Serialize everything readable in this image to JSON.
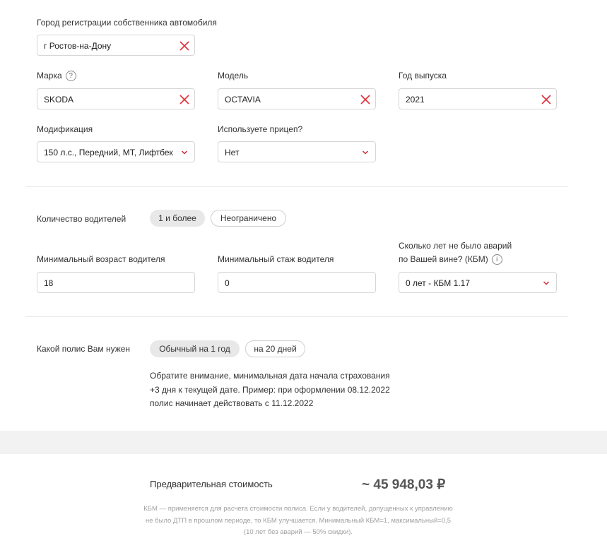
{
  "vehicle": {
    "city_label": "Город регистрации собственника автомобиля",
    "city_value": "г Ростов-на-Дону",
    "brand_label": "Марка",
    "brand_help": "?",
    "brand_value": "SKODA",
    "model_label": "Модель",
    "model_value": "OCTAVIA",
    "year_label": "Год выпуска",
    "year_value": "2021",
    "modification_label": "Модификация",
    "modification_value": "150 л.с., Передний, МТ, Лифтбек",
    "trailer_label": "Используете прицеп?",
    "trailer_value": "Нет"
  },
  "drivers": {
    "count_label": "Количество водителей",
    "count_options": [
      "1 и более",
      "Неограничено"
    ],
    "count_selected": "1 и более",
    "min_age_label": "Минимальный возраст водителя",
    "min_age_value": "18",
    "min_exp_label": "Минимальный стаж водителя",
    "min_exp_value": "0",
    "kbm_label_line1": "Сколько лет не было аварий",
    "kbm_label_line2": "по Вашей вине? (КБМ)",
    "kbm_info": "i",
    "kbm_value": "0 лет - КБМ 1.17"
  },
  "policy": {
    "label": "Какой полис Вам нужен",
    "options": [
      "Обычный на 1 год",
      "на 20 дней"
    ],
    "selected": "Обычный на 1 год",
    "notice_line1": "Обратите внимание, минимальная дата начала страхования",
    "notice_line2": "+3 дня к текущей дате. Пример: при оформлении 08.12.2022",
    "notice_line3": "полис начинает действовать с 11.12.2022"
  },
  "summary": {
    "price_label": "Предварительная стоимость",
    "price_value": "~ 45 948,03 ₽",
    "footnote_line1": "КБМ — применяется для расчета стоимости полиса. Если у водителей, допущенных к управлению",
    "footnote_line2": "не было ДТП в прошлом периоде, то КБМ улучшается. Минимальный КБМ=1, максимальный=0,5",
    "footnote_line3": "(10 лет без аварий — 50% скидки)."
  },
  "colors": {
    "clear_icon": "#e0303a",
    "chevron_icon": "#d02a35",
    "active_pill": "#e8e8e8",
    "band": "#f2f2f2"
  }
}
